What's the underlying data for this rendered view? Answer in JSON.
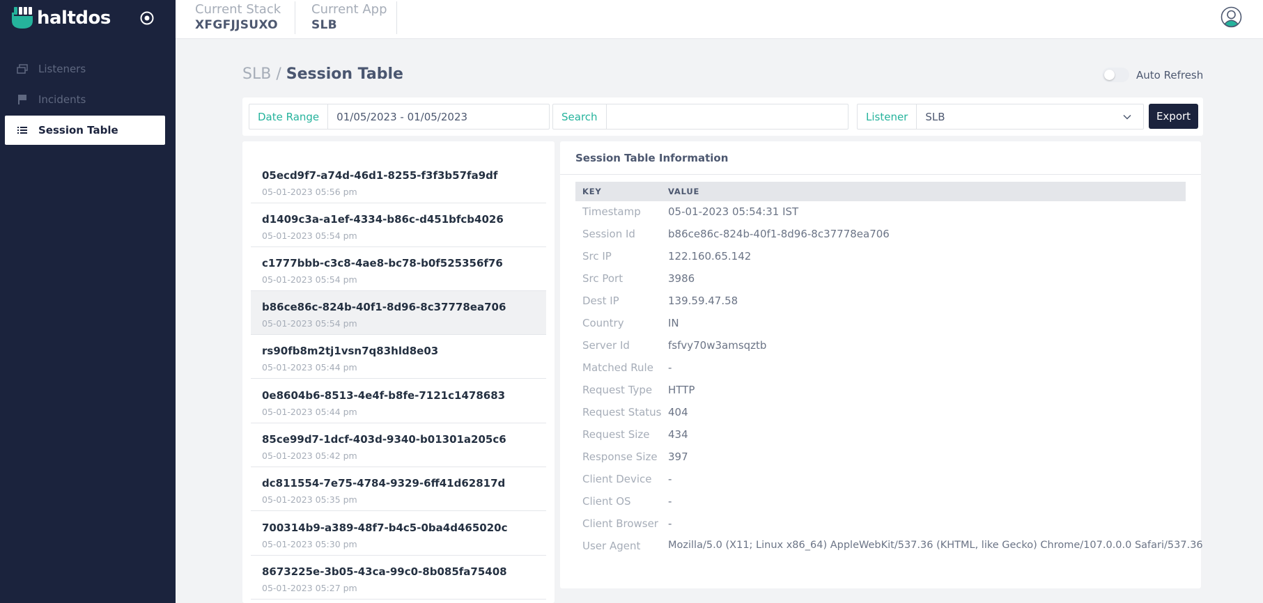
{
  "brand": {
    "name": "haltdos"
  },
  "sidebar": {
    "items": [
      {
        "label": "Listeners",
        "icon": "windows-icon",
        "active": false
      },
      {
        "label": "Incidents",
        "icon": "flag-icon",
        "active": false
      },
      {
        "label": "Session Table",
        "icon": "list-icon",
        "active": true
      }
    ]
  },
  "topbar": {
    "stack_label": "Current Stack",
    "stack_value": "XFGFJJSUXO",
    "app_label": "Current App",
    "app_value": "SLB"
  },
  "page": {
    "breadcrumb_parent": "SLB",
    "breadcrumb_sep": "/",
    "title": "Session Table",
    "auto_refresh_label": "Auto Refresh",
    "auto_refresh_on": false
  },
  "filters": {
    "date_label": "Date Range",
    "date_value": "01/05/2023 - 01/05/2023",
    "search_label": "Search",
    "search_value": "",
    "listener_label": "Listener",
    "listener_value": "SLB",
    "export_label": "Export"
  },
  "sessions": [
    {
      "id": "05ecd9f7-a74d-46d1-8255-f3f3b57fa9df",
      "time": "05-01-2023 05:56 pm",
      "selected": false
    },
    {
      "id": "d1409c3a-a1ef-4334-b86c-d451bfcb4026",
      "time": "05-01-2023 05:54 pm",
      "selected": false
    },
    {
      "id": "c1777bbb-c3c8-4ae8-bc78-b0f525356f76",
      "time": "05-01-2023 05:54 pm",
      "selected": false
    },
    {
      "id": "b86ce86c-824b-40f1-8d96-8c37778ea706",
      "time": "05-01-2023 05:54 pm",
      "selected": true
    },
    {
      "id": "rs90fb8m2tj1vsn7q83hld8e03",
      "time": "05-01-2023 05:44 pm",
      "selected": false
    },
    {
      "id": "0e8604b6-8513-4e4f-b8fe-7121c1478683",
      "time": "05-01-2023 05:44 pm",
      "selected": false
    },
    {
      "id": "85ce99d7-1dcf-403d-9340-b01301a205c6",
      "time": "05-01-2023 05:42 pm",
      "selected": false
    },
    {
      "id": "dc811554-7e75-4784-9329-6ff41d62817d",
      "time": "05-01-2023 05:35 pm",
      "selected": false
    },
    {
      "id": "700314b9-a389-48f7-b4c5-0ba4d465020c",
      "time": "05-01-2023 05:30 pm",
      "selected": false
    },
    {
      "id": "8673225e-3b05-43ca-99c0-8b085fa75408",
      "time": "05-01-2023 05:27 pm",
      "selected": false
    }
  ],
  "info": {
    "title": "Session Table Information",
    "key_header": "KEY",
    "value_header": "VALUE",
    "rows": [
      {
        "key": "Timestamp",
        "value": "05-01-2023 05:54:31 IST"
      },
      {
        "key": "Session Id",
        "value": "b86ce86c-824b-40f1-8d96-8c37778ea706"
      },
      {
        "key": "Src IP",
        "value": "122.160.65.142"
      },
      {
        "key": "Src Port",
        "value": "3986"
      },
      {
        "key": "Dest IP",
        "value": "139.59.47.58"
      },
      {
        "key": "Country",
        "value": "IN"
      },
      {
        "key": "Server Id",
        "value": "fsfvy70w3amsqztb"
      },
      {
        "key": "Matched Rule",
        "value": "-"
      },
      {
        "key": "Request Type",
        "value": "HTTP"
      },
      {
        "key": "Request Status",
        "value": "404"
      },
      {
        "key": "Request Size",
        "value": "434"
      },
      {
        "key": "Response Size",
        "value": "397"
      },
      {
        "key": "Client Device",
        "value": "-"
      },
      {
        "key": "Client OS",
        "value": "-"
      },
      {
        "key": "Client Browser",
        "value": "-"
      },
      {
        "key": "User Agent",
        "value": "Mozilla/5.0 (X11; Linux x86_64) AppleWebKit/537.36 (KHTML, like Gecko) Chrome/107.0.0.0 Safari/537.36"
      }
    ]
  },
  "colors": {
    "sidebar_bg": "#1b233d",
    "accent": "#25b39c",
    "page_bg": "#f2f3f5"
  }
}
